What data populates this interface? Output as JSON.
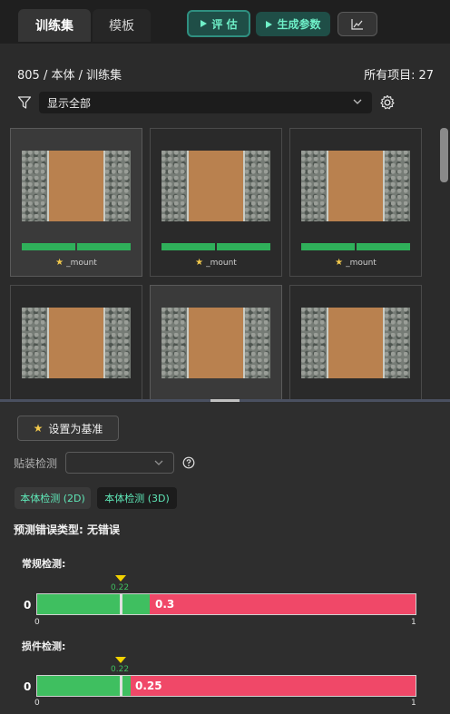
{
  "tabs": {
    "train": "训练集",
    "template": "模板"
  },
  "toolbar": {
    "eval": "评 估",
    "gen_params": "生成参数",
    "chart_icon": "chart-icon"
  },
  "header": {
    "breadcrumb": "805 / 本体 / 训练集",
    "all_items_label": "所有项目:",
    "all_items_count": "27"
  },
  "filter": {
    "value": "显示全部"
  },
  "cards": [
    {
      "tag": "_mount",
      "selected": true
    },
    {
      "tag": "_mount",
      "selected": false
    },
    {
      "tag": "_mount",
      "selected": false
    },
    {
      "tag": "",
      "selected": false
    },
    {
      "tag": "",
      "selected": true
    },
    {
      "tag": "",
      "selected": false
    }
  ],
  "bottom": {
    "set_base": "设置为基准",
    "mount_label": "贴装检测",
    "mount_value": "",
    "tabs": [
      "本体检测 (2D)",
      "本体检测 (3D)"
    ],
    "prediction": "预测错误类型: 无错误",
    "normal": {
      "label": "常规检测:",
      "zero": "0",
      "threshold": "0.22",
      "value": "0.3",
      "axis_min": "0",
      "axis_max": "1"
    },
    "damage": {
      "label": "损件检测:",
      "zero": "0",
      "threshold": "0.22",
      "value": "0.25",
      "axis_min": "0",
      "axis_max": "1"
    }
  },
  "colors": {
    "accent": "#6ff0c8",
    "ok": "#3fbf60",
    "ng": "#f04868",
    "star": "#f2c94c",
    "threshold": "#f2d200"
  }
}
